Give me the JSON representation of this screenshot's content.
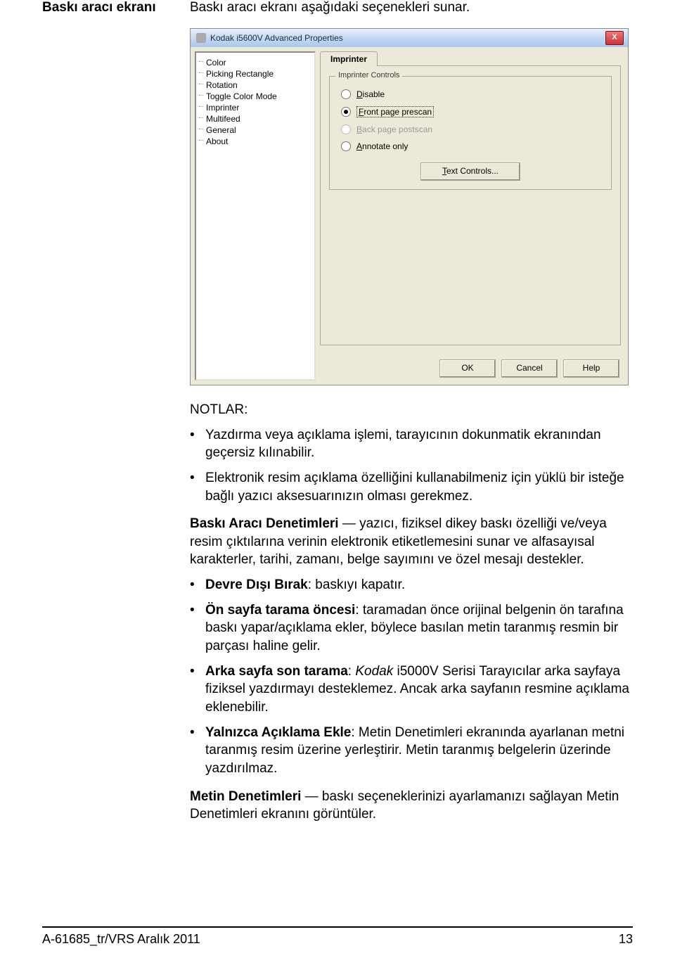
{
  "sideHeading": "Baskı aracı ekranı",
  "intro": "Baskı aracı ekranı aşağıdaki seçenekleri sunar.",
  "dialog": {
    "title": "Kodak i5600V Advanced Properties",
    "closeX": "X",
    "treeItems": [
      "Color",
      "Picking Rectangle",
      "Rotation",
      "Toggle Color Mode",
      "Imprinter",
      "Multifeed",
      "General",
      "About"
    ],
    "tabLabel": "Imprinter",
    "groupLegend": "Imprinter Controls",
    "radios": {
      "disable": {
        "pre": "",
        "u": "D",
        "post": "isable"
      },
      "frontPre": {
        "pre": "",
        "u": "F",
        "post": "ront page prescan"
      },
      "backPost": {
        "pre": "",
        "u": "B",
        "post": "ack page postscan"
      },
      "annotate": {
        "pre": "",
        "u": "A",
        "post": "nnotate only"
      }
    },
    "textControlsBtn": {
      "pre": "",
      "u": "T",
      "post": "ext Controls..."
    },
    "buttons": {
      "ok": "OK",
      "cancel": "Cancel",
      "help": "Help"
    }
  },
  "notesLabel": "NOTLAR:",
  "bullets1": [
    "Yazdırma veya açıklama işlemi, tarayıcının dokunmatik ekranından geçersiz kılınabilir.",
    "Elektronik resim açıklama özelliğini kullanabilmeniz için yüklü bir isteğe bağlı yazıcı aksesuarınızın olması gerekmez."
  ],
  "para1a": "Baskı Aracı Denetimleri",
  "para1b": " — yazıcı, fiziksel dikey baskı özelliği ve/veya resim çıktılarına verinin elektronik etiketlemesini sunar ve alfasayısal karakterler, tarihi, zamanı, belge sayımını ve özel mesajı destekler.",
  "bul_devre_a": "Devre Dışı Bırak",
  "bul_devre_b": ": baskıyı kapatır.",
  "bul_on_a": "Ön sayfa tarama öncesi",
  "bul_on_b": ": taramadan önce orijinal belgenin ön tarafına baskı yapar/açıklama ekler, böylece basılan metin taranmış resmin bir parçası haline gelir.",
  "bul_arka_a": "Arka sayfa son tarama",
  "bul_arka_b": ": ",
  "bul_arka_c": "Kodak",
  "bul_arka_d": " i5000V Serisi Tarayıcılar arka sayfaya fiziksel yazdırmayı desteklemez. Ancak arka sayfanın resmine açıklama eklenebilir.",
  "bul_yal_a": "Yalnızca Açıklama Ekle",
  "bul_yal_b": ": Metin Denetimleri ekranında ayarlanan metni taranmış resim üzerine yerleştirir. Metin taranmış belgelerin üzerinde yazdırılmaz.",
  "para2a": "Metin Denetimleri",
  "para2b": " — baskı seçeneklerinizi ayarlamanızı sağlayan Metin Denetimleri ekranını görüntüler.",
  "footer": {
    "left": "A-61685_tr/VRS  Aralık 2011",
    "right": "13"
  }
}
